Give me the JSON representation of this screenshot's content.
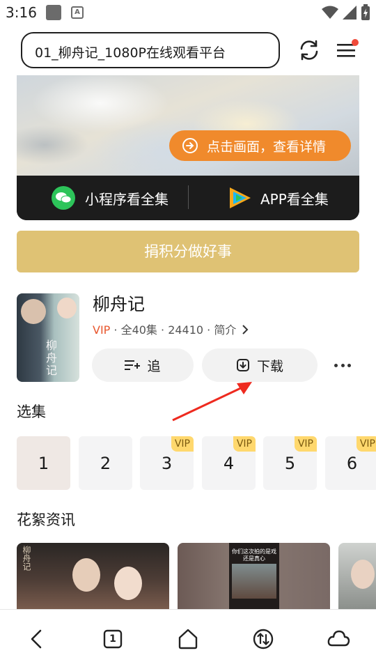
{
  "status_bar": {
    "time": "3:16",
    "app_badge": "A"
  },
  "browser": {
    "url_text": "01_柳舟记_1080P在线观看平台",
    "menu_notification_color": "#f04a3a"
  },
  "player": {
    "detail_button": "点击画面，查看详情",
    "mini_program_button": "小程序看全集",
    "app_button": "APP看全集"
  },
  "donate_button": "捐积分做好事",
  "drama": {
    "poster_title": "柳舟记",
    "title": "柳舟记",
    "vip_label": "VIP",
    "meta_text": " · 全40集 · 24410 · 简介",
    "follow_button": "追",
    "download_button": "下载"
  },
  "episodes": {
    "title": "选集",
    "items": [
      {
        "number": "1",
        "vip": ""
      },
      {
        "number": "2",
        "vip": ""
      },
      {
        "number": "3",
        "vip": "VIP"
      },
      {
        "number": "4",
        "vip": "VIP"
      },
      {
        "number": "5",
        "vip": "VIP"
      },
      {
        "number": "6",
        "vip": "VIP"
      }
    ]
  },
  "news": {
    "title": "花絮资讯",
    "thumb1_mark": "柳舟记",
    "thumb2_caption": "你们这次拍的是戏还是真心"
  },
  "colors": {
    "accent_orange": "#f08a2c",
    "donate_gold": "#dfc274",
    "vip_red": "#e8572e",
    "vip_badge": "#ffd86e",
    "wechat_green": "#2dc45a"
  },
  "bottom_nav": {
    "tab_count": "1"
  }
}
